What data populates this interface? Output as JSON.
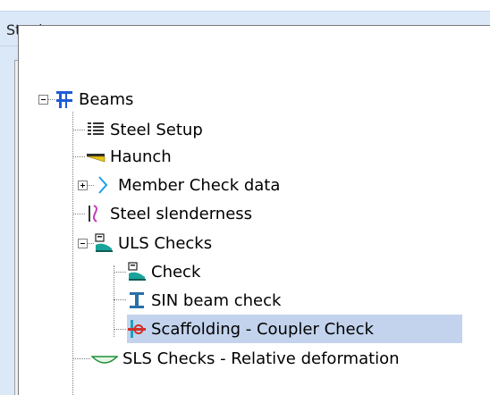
{
  "window": {
    "title": "Steel"
  },
  "tree": {
    "root": {
      "label": "Beams",
      "icon": "beams-icon",
      "state": "expanded"
    },
    "items": [
      {
        "label": "Steel Setup",
        "icon": "steel-setup-icon"
      },
      {
        "label": "Haunch",
        "icon": "haunch-icon"
      },
      {
        "label": "Member Check data",
        "icon": "member-check-data-icon",
        "state": "collapsed"
      },
      {
        "label": "Steel slenderness",
        "icon": "steel-slenderness-icon"
      },
      {
        "label": "ULS Checks",
        "icon": "uls-checks-icon",
        "state": "expanded"
      },
      {
        "label": "Check",
        "icon": "check-icon"
      },
      {
        "label": "SIN beam check",
        "icon": "sin-beam-check-icon"
      },
      {
        "label": "Scaffolding - Coupler Check",
        "icon": "scaffolding-coupler-check-icon",
        "selected": true
      },
      {
        "label": "SLS Checks - Relative deformation",
        "icon": "sls-checks-icon"
      }
    ]
  },
  "colors": {
    "titlebar": "#dbe8f7",
    "selection": "#c3d3ed",
    "accent": "#1e5bd8"
  }
}
